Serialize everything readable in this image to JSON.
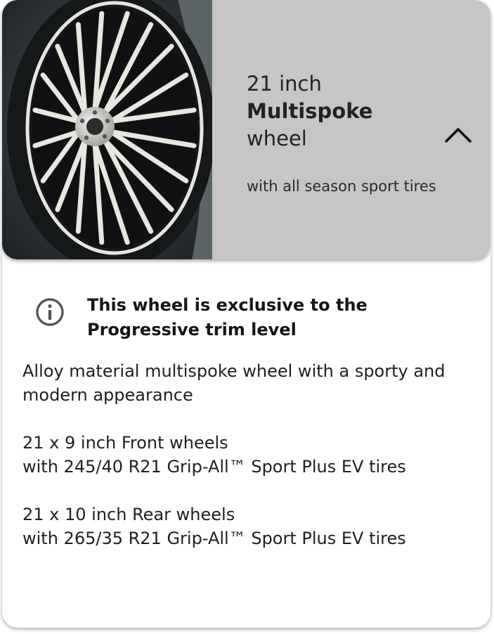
{
  "wheel_option": {
    "size": "21 inch",
    "name": "Multispoke",
    "kind": "wheel",
    "tire_note": "with all season sport tires",
    "image": "multispoke-wheel-photo",
    "toggle_icon": "chevron-up-icon",
    "expanded": true
  },
  "notice": {
    "icon": "info-icon",
    "text": "This wheel is exclusive to the Progressive trim level"
  },
  "description": "Alloy material multispoke wheel with a sporty and modern appearance",
  "specs": [
    {
      "title": "21 x 9 inch Front wheels",
      "detail": "with 245/40 R21 Grip-All™ Sport Plus EV tires"
    },
    {
      "title": "21 x 10 inch Rear wheels",
      "detail": "with 265/35 R21 Grip-All™ Sport Plus EV tires"
    }
  ],
  "colors": {
    "header_background": "#c6c6c6",
    "card_background": "#ffffff",
    "text": "#1a1a1a"
  }
}
